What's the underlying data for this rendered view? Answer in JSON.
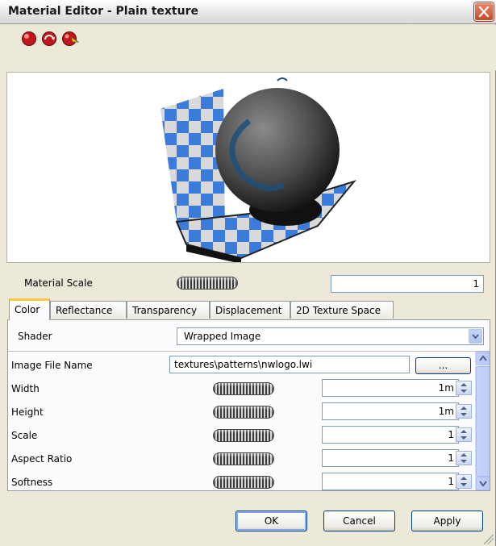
{
  "window": {
    "title": "Material Editor - Plain texture"
  },
  "toolbar": {
    "icons": [
      "sphere-material-icon",
      "rotate-preview-icon",
      "light-preview-icon"
    ]
  },
  "material_scale": {
    "label": "Material Scale",
    "value": "1"
  },
  "tabs": [
    {
      "label": "Color",
      "active": true
    },
    {
      "label": "Reflectance"
    },
    {
      "label": "Transparency"
    },
    {
      "label": "Displacement"
    },
    {
      "label": "2D Texture Space"
    }
  ],
  "shader": {
    "label": "Shader",
    "value": "Wrapped Image"
  },
  "properties": {
    "image_file": {
      "label": "Image File Name",
      "value": "textures\\patterns\\nwlogo.lwi",
      "browse_label": "..."
    },
    "width": {
      "label": "Width",
      "value": "1m"
    },
    "height": {
      "label": "Height",
      "value": "1m"
    },
    "scale": {
      "label": "Scale",
      "value": "1"
    },
    "aspect": {
      "label": "Aspect Ratio",
      "value": "1"
    },
    "softness": {
      "label": "Softness",
      "value": "1"
    }
  },
  "buttons": {
    "ok": "OK",
    "cancel": "Cancel",
    "apply": "Apply"
  },
  "colors": {
    "accent_tab": "#ffc83c",
    "close_red": "#c54a2a",
    "checker_blue": "#3a7bdc"
  }
}
